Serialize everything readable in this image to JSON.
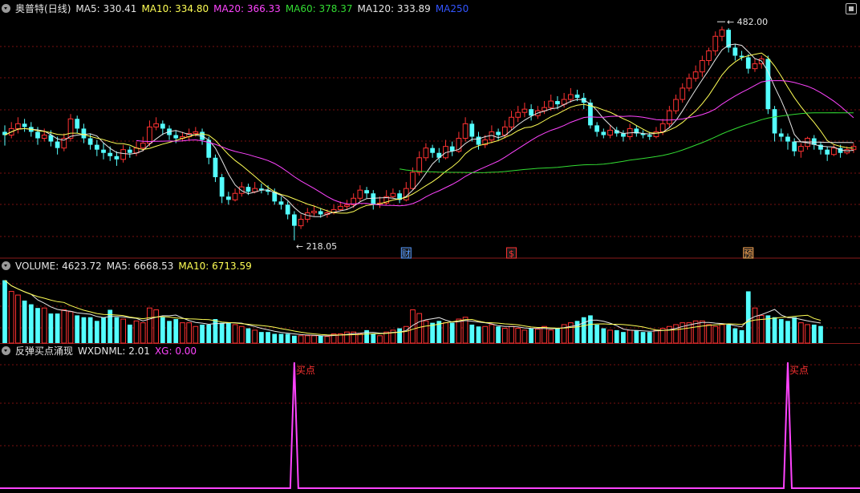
{
  "stock": {
    "name": "奥普特",
    "period": "(日线)"
  },
  "main_legend": [
    {
      "label": "MA5: 330.41",
      "color": "#e6e6e6"
    },
    {
      "label": "MA10: 334.80",
      "color": "#ffff55"
    },
    {
      "label": "MA20: 366.33",
      "color": "#ff44ff"
    },
    {
      "label": "MA60: 378.37",
      "color": "#33dd33"
    },
    {
      "label": "MA120: 333.89",
      "color": "#e6e6e6"
    },
    {
      "label": "MA250",
      "color": "#3355ff"
    }
  ],
  "vol_legend": [
    {
      "label": "VOLUME: 4623.72",
      "color": "#e6e6e6"
    },
    {
      "label": "MA5: 6668.53",
      "color": "#e6e6e6"
    },
    {
      "label": "MA10: 6713.59",
      "color": "#ffff55"
    }
  ],
  "ind_legend": [
    {
      "label": "反弹买点涌现",
      "color": "#e6e6e6"
    },
    {
      "label": "WXDNML: 2.01",
      "color": "#e6e6e6"
    },
    {
      "label": "XG: 0.00",
      "color": "#ff44ff"
    }
  ],
  "markers": {
    "high_label": "482.00",
    "low_label": "218.05"
  },
  "event_tags": [
    {
      "text": "财",
      "bar": 61,
      "color": "#5599ff"
    },
    {
      "text": "$",
      "bar": 77,
      "color": "#ff3333"
    },
    {
      "text": "预",
      "bar": 113,
      "color": "#ffaa55"
    }
  ],
  "buy_signal_label": "买点",
  "colors": {
    "up": "#ff3232",
    "down": "#54ffff",
    "grid": "#7a1010",
    "divider": "#8b1b1b",
    "signal": "#ff44ff"
  },
  "chart_data": [
    {
      "type": "candlestick",
      "title": "奥普特 (日线)",
      "candles": [
        [
          352,
          348,
          360,
          335
        ],
        [
          348,
          356,
          364,
          344
        ],
        [
          356,
          362,
          370,
          350
        ],
        [
          362,
          358,
          368,
          352
        ],
        [
          358,
          352,
          364,
          346
        ],
        [
          352,
          344,
          358,
          336
        ],
        [
          344,
          348,
          356,
          340
        ],
        [
          348,
          340,
          354,
          334
        ],
        [
          340,
          332,
          346,
          324
        ],
        [
          332,
          344,
          350,
          328
        ],
        [
          344,
          368,
          374,
          340
        ],
        [
          368,
          356,
          372,
          350
        ],
        [
          356,
          344,
          362,
          338
        ],
        [
          344,
          336,
          350,
          330
        ],
        [
          336,
          330,
          342,
          322
        ],
        [
          330,
          326,
          338,
          318
        ],
        [
          326,
          322,
          334,
          316
        ],
        [
          322,
          318,
          328,
          310
        ],
        [
          318,
          330,
          336,
          314
        ],
        [
          330,
          326,
          334,
          320
        ],
        [
          326,
          332,
          340,
          322
        ],
        [
          332,
          338,
          346,
          328
        ],
        [
          338,
          358,
          366,
          334
        ],
        [
          358,
          362,
          370,
          354
        ],
        [
          362,
          356,
          366,
          348
        ],
        [
          356,
          348,
          360,
          342
        ],
        [
          348,
          344,
          354,
          338
        ],
        [
          344,
          346,
          352,
          340
        ],
        [
          346,
          350,
          356,
          342
        ],
        [
          350,
          352,
          358,
          346
        ],
        [
          352,
          342,
          356,
          336
        ],
        [
          342,
          320,
          346,
          312
        ],
        [
          320,
          296,
          324,
          290
        ],
        [
          296,
          272,
          300,
          264
        ],
        [
          272,
          268,
          278,
          262
        ],
        [
          268,
          276,
          282,
          266
        ],
        [
          276,
          284,
          290,
          272
        ],
        [
          284,
          278,
          288,
          274
        ],
        [
          278,
          282,
          290,
          276
        ],
        [
          282,
          280,
          288,
          276
        ],
        [
          280,
          278,
          286,
          274
        ],
        [
          278,
          266,
          282,
          262
        ],
        [
          266,
          262,
          272,
          256
        ],
        [
          262,
          250,
          266,
          244
        ],
        [
          250,
          236,
          254,
          218
        ],
        [
          236,
          244,
          250,
          232
        ],
        [
          244,
          252,
          258,
          240
        ],
        [
          252,
          254,
          260,
          248
        ],
        [
          254,
          250,
          258,
          246
        ],
        [
          250,
          252,
          256,
          246
        ],
        [
          252,
          256,
          262,
          250
        ],
        [
          256,
          260,
          266,
          254
        ],
        [
          260,
          262,
          268,
          256
        ],
        [
          262,
          270,
          276,
          258
        ],
        [
          270,
          280,
          286,
          266
        ],
        [
          280,
          276,
          284,
          270
        ],
        [
          276,
          262,
          280,
          256
        ],
        [
          262,
          264,
          272,
          258
        ],
        [
          264,
          272,
          280,
          262
        ],
        [
          272,
          276,
          282,
          270
        ],
        [
          276,
          268,
          280,
          264
        ],
        [
          268,
          282,
          290,
          266
        ],
        [
          282,
          302,
          308,
          280
        ],
        [
          302,
          320,
          328,
          298
        ],
        [
          320,
          332,
          338,
          316
        ],
        [
          332,
          326,
          336,
          320
        ],
        [
          326,
          320,
          332,
          314
        ],
        [
          320,
          334,
          342,
          318
        ],
        [
          334,
          328,
          340,
          322
        ],
        [
          328,
          344,
          352,
          326
        ],
        [
          344,
          362,
          370,
          340
        ],
        [
          362,
          346,
          366,
          340
        ],
        [
          346,
          336,
          352,
          330
        ],
        [
          336,
          342,
          348,
          332
        ],
        [
          342,
          352,
          360,
          338
        ],
        [
          352,
          348,
          356,
          342
        ],
        [
          348,
          358,
          366,
          344
        ],
        [
          358,
          370,
          378,
          354
        ],
        [
          370,
          376,
          384,
          364
        ],
        [
          376,
          380,
          388,
          370
        ],
        [
          380,
          372,
          386,
          366
        ],
        [
          372,
          378,
          384,
          368
        ],
        [
          378,
          382,
          390,
          374
        ],
        [
          382,
          390,
          398,
          378
        ],
        [
          390,
          386,
          396,
          380
        ],
        [
          386,
          392,
          400,
          382
        ],
        [
          392,
          398,
          406,
          388
        ],
        [
          398,
          394,
          404,
          390
        ],
        [
          394,
          388,
          400,
          380
        ],
        [
          388,
          360,
          392,
          356
        ],
        [
          360,
          352,
          364,
          346
        ],
        [
          352,
          348,
          356,
          344
        ],
        [
          348,
          354,
          360,
          344
        ],
        [
          354,
          350,
          358,
          346
        ],
        [
          350,
          346,
          354,
          340
        ],
        [
          346,
          356,
          362,
          342
        ],
        [
          356,
          350,
          360,
          346
        ],
        [
          350,
          348,
          354,
          344
        ],
        [
          348,
          346,
          352,
          342
        ],
        [
          346,
          352,
          358,
          344
        ],
        [
          352,
          362,
          368,
          348
        ],
        [
          362,
          378,
          384,
          358
        ],
        [
          378,
          392,
          398,
          374
        ],
        [
          392,
          406,
          412,
          388
        ],
        [
          406,
          418,
          424,
          402
        ],
        [
          418,
          426,
          434,
          414
        ],
        [
          426,
          440,
          446,
          420
        ],
        [
          440,
          452,
          456,
          434
        ],
        [
          452,
          470,
          476,
          446
        ],
        [
          470,
          478,
          482,
          464
        ],
        [
          478,
          456,
          480,
          450
        ],
        [
          456,
          446,
          460,
          440
        ],
        [
          446,
          444,
          452,
          440
        ],
        [
          444,
          430,
          448,
          424
        ],
        [
          430,
          436,
          442,
          426
        ],
        [
          436,
          442,
          446,
          430
        ],
        [
          442,
          380,
          446,
          374
        ],
        [
          380,
          350,
          384,
          340
        ],
        [
          350,
          346,
          356,
          340
        ],
        [
          346,
          340,
          350,
          330
        ],
        [
          340,
          328,
          344,
          322
        ],
        [
          328,
          334,
          338,
          320
        ],
        [
          334,
          344,
          346,
          330
        ],
        [
          344,
          336,
          348,
          330
        ],
        [
          336,
          330,
          340,
          324
        ],
        [
          330,
          324,
          334,
          316
        ],
        [
          324,
          332,
          336,
          322
        ],
        [
          332,
          326,
          336,
          320
        ],
        [
          326,
          330,
          334,
          324
        ],
        [
          330,
          334,
          338,
          326
        ]
      ],
      "ma_lines": [
        {
          "name": "MA5",
          "color": "#e6e6e6"
        },
        {
          "name": "MA10",
          "color": "#ffff55"
        },
        {
          "name": "MA20",
          "color": "#ff44ff"
        },
        {
          "name": "MA60",
          "color": "#33dd33"
        },
        {
          "name": "MA120",
          "color": "#e6e6e6"
        }
      ],
      "ylim": [
        200,
        495
      ]
    },
    {
      "type": "bar",
      "title": "VOLUME",
      "values": [
        17000,
        14000,
        13000,
        11500,
        10500,
        9500,
        9500,
        8000,
        8000,
        9000,
        8500,
        7500,
        7000,
        7000,
        6000,
        7000,
        9000,
        7000,
        6500,
        5000,
        6000,
        5500,
        9500,
        9000,
        7000,
        6000,
        6500,
        5500,
        5500,
        4500,
        5000,
        5000,
        6500,
        5500,
        5500,
        5000,
        4500,
        4000,
        3500,
        3000,
        3000,
        2500,
        2500,
        2500,
        2000,
        2000,
        2000,
        2000,
        2000,
        1800,
        2500,
        2500,
        3000,
        3000,
        2500,
        3500,
        2500,
        2000,
        3000,
        3500,
        4000,
        4500,
        9000,
        8000,
        6000,
        5500,
        6000,
        5500,
        5500,
        6500,
        7000,
        5000,
        4500,
        4500,
        5000,
        4500,
        4000,
        4500,
        4000,
        3500,
        4000,
        3800,
        4500,
        3500,
        4000,
        5000,
        5500,
        6000,
        7000,
        7500,
        5000,
        4000,
        3500,
        3500,
        3000,
        3500,
        3500,
        3000,
        3000,
        3500,
        4000,
        4500,
        5000,
        5500,
        5500,
        6000,
        6000,
        5000,
        4500,
        5000,
        5000,
        4000,
        3500,
        14000,
        9500,
        7500,
        7500,
        7000,
        6500,
        6000,
        7000,
        5500,
        5000,
        5000,
        4623.72
      ],
      "ylim": [
        0,
        18000
      ]
    },
    {
      "type": "line",
      "title": "反弹买点涌现",
      "series": [
        {
          "name": "XG",
          "color": "#ff44ff",
          "spikes": [
            44,
            119
          ]
        }
      ],
      "annotations": [
        "买点",
        "买点"
      ],
      "ylim": [
        0,
        1
      ]
    }
  ]
}
